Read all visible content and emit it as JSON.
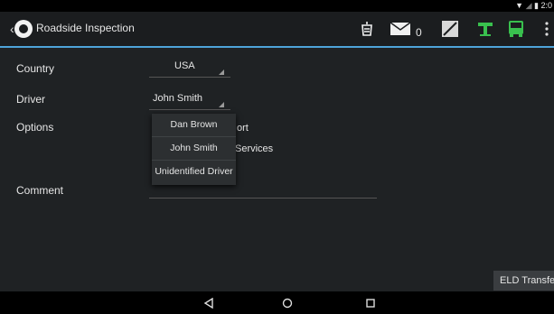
{
  "status_bar": {
    "icons": [
      "wifi-icon",
      "signal-icon",
      "battery-icon"
    ],
    "time": "2:0"
  },
  "app_bar": {
    "back_icon": "back-arrow-icon",
    "title": "Roadside Inspection",
    "message_count": "0",
    "actions": [
      "fuel-icon",
      "mail-icon",
      "edit-icon",
      "signal-tower-icon",
      "bus-icon",
      "overflow-menu-icon"
    ],
    "accent": "#4ea3d9",
    "green": "#39c04e"
  },
  "form": {
    "country_label": "Country",
    "country_value": "USA",
    "driver_label": "Driver",
    "driver_value": "John Smith",
    "options_label": "Options",
    "option1_text": "ort",
    "option2_text": "Services",
    "comment_label": "Comment"
  },
  "driver_dropdown": {
    "options": [
      "Dan Brown",
      "John Smith",
      "Unidentified Driver"
    ]
  },
  "eld_transfer_button": "ELD Transfe",
  "nav_bar": {
    "icons": [
      "back-triangle-icon",
      "home-circle-icon",
      "recents-square-icon"
    ]
  }
}
